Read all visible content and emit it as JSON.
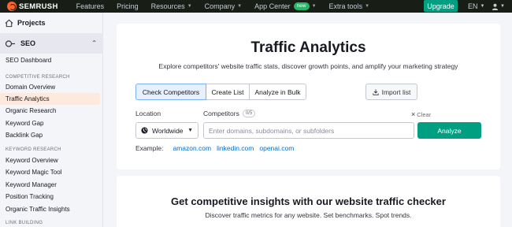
{
  "topnav": {
    "logo": "SEMRUSH",
    "items": [
      {
        "label": "Features",
        "dropdown": false
      },
      {
        "label": "Pricing",
        "dropdown": false
      },
      {
        "label": "Resources",
        "dropdown": true
      },
      {
        "label": "Company",
        "dropdown": true
      },
      {
        "label": "App Center",
        "dropdown": true,
        "badge": "new"
      },
      {
        "label": "Extra tools",
        "dropdown": true
      }
    ],
    "upgrade_label": "Upgrade",
    "language": "EN",
    "user_icon": "user-icon"
  },
  "sidebar": {
    "projects_label": "Projects",
    "seo_label": "SEO",
    "links": [
      {
        "label": "SEO Dashboard",
        "type": "link"
      },
      {
        "label": "COMPETITIVE RESEARCH",
        "type": "heading"
      },
      {
        "label": "Domain Overview",
        "type": "link"
      },
      {
        "label": "Traffic Analytics",
        "type": "link",
        "active": true
      },
      {
        "label": "Organic Research",
        "type": "link"
      },
      {
        "label": "Keyword Gap",
        "type": "link"
      },
      {
        "label": "Backlink Gap",
        "type": "link"
      },
      {
        "label": "KEYWORD RESEARCH",
        "type": "heading"
      },
      {
        "label": "Keyword Overview",
        "type": "link"
      },
      {
        "label": "Keyword Magic Tool",
        "type": "link"
      },
      {
        "label": "Keyword Manager",
        "type": "link"
      },
      {
        "label": "Position Tracking",
        "type": "link"
      },
      {
        "label": "Organic Traffic Insights",
        "type": "link"
      },
      {
        "label": "LINK BUILDING",
        "type": "heading"
      }
    ]
  },
  "main": {
    "title": "Traffic Analytics",
    "subtitle": "Explore competitors' website traffic stats, discover growth points, and amplify your marketing strategy",
    "tabs": [
      {
        "label": "Check Competitors",
        "active": true
      },
      {
        "label": "Create List",
        "active": false
      },
      {
        "label": "Analyze in Bulk",
        "active": false
      }
    ],
    "import_label": "Import list",
    "location_label": "Location",
    "location_value": "Worldwide",
    "competitors_label": "Competitors",
    "competitors_count": "0/5",
    "clear_label": "Clear",
    "competitors_placeholder": "Enter domains, subdomains, or subfolders",
    "analyze_label": "Analyze",
    "example_label": "Example:",
    "examples": [
      "amazon.com",
      "linkedin.com",
      "openai.com"
    ]
  },
  "insights": {
    "title": "Get competitive insights with our website traffic checker",
    "subtitle": "Discover traffic metrics for any website. Set benchmarks. Spot trends."
  },
  "colors": {
    "topnav_bg": "#181e15",
    "accent_green": "#009f81",
    "brand_orange": "#ff642d",
    "active_sidebar_bg": "#fde9de",
    "link_blue": "#006dca"
  }
}
